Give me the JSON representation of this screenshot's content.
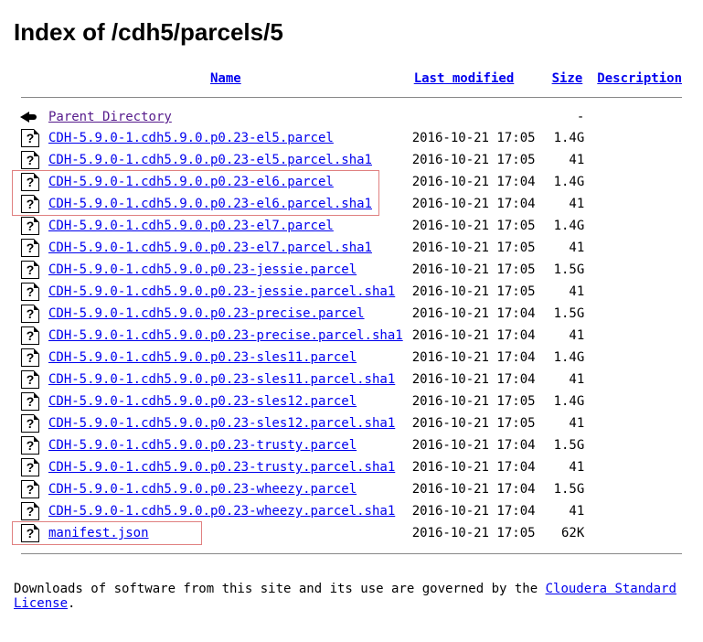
{
  "title": "Index of /cdh5/parcels/5",
  "headers": {
    "name": "Name",
    "last_modified": "Last modified",
    "size": "Size",
    "description": "Description"
  },
  "parent": {
    "label": "Parent Directory",
    "size": "-"
  },
  "files": [
    {
      "name": "CDH-5.9.0-1.cdh5.9.0.p0.23-el5.parcel",
      "date": "2016-10-21 17:05",
      "size": "1.4G"
    },
    {
      "name": "CDH-5.9.0-1.cdh5.9.0.p0.23-el5.parcel.sha1",
      "date": "2016-10-21 17:05",
      "size": "41"
    },
    {
      "name": "CDH-5.9.0-1.cdh5.9.0.p0.23-el6.parcel",
      "date": "2016-10-21 17:04",
      "size": "1.4G"
    },
    {
      "name": "CDH-5.9.0-1.cdh5.9.0.p0.23-el6.parcel.sha1",
      "date": "2016-10-21 17:04",
      "size": "41"
    },
    {
      "name": "CDH-5.9.0-1.cdh5.9.0.p0.23-el7.parcel",
      "date": "2016-10-21 17:05",
      "size": "1.4G"
    },
    {
      "name": "CDH-5.9.0-1.cdh5.9.0.p0.23-el7.parcel.sha1",
      "date": "2016-10-21 17:05",
      "size": "41"
    },
    {
      "name": "CDH-5.9.0-1.cdh5.9.0.p0.23-jessie.parcel",
      "date": "2016-10-21 17:05",
      "size": "1.5G"
    },
    {
      "name": "CDH-5.9.0-1.cdh5.9.0.p0.23-jessie.parcel.sha1",
      "date": "2016-10-21 17:05",
      "size": "41"
    },
    {
      "name": "CDH-5.9.0-1.cdh5.9.0.p0.23-precise.parcel",
      "date": "2016-10-21 17:04",
      "size": "1.5G"
    },
    {
      "name": "CDH-5.9.0-1.cdh5.9.0.p0.23-precise.parcel.sha1",
      "date": "2016-10-21 17:04",
      "size": "41"
    },
    {
      "name": "CDH-5.9.0-1.cdh5.9.0.p0.23-sles11.parcel",
      "date": "2016-10-21 17:04",
      "size": "1.4G"
    },
    {
      "name": "CDH-5.9.0-1.cdh5.9.0.p0.23-sles11.parcel.sha1",
      "date": "2016-10-21 17:04",
      "size": "41"
    },
    {
      "name": "CDH-5.9.0-1.cdh5.9.0.p0.23-sles12.parcel",
      "date": "2016-10-21 17:05",
      "size": "1.4G"
    },
    {
      "name": "CDH-5.9.0-1.cdh5.9.0.p0.23-sles12.parcel.sha1",
      "date": "2016-10-21 17:05",
      "size": "41"
    },
    {
      "name": "CDH-5.9.0-1.cdh5.9.0.p0.23-trusty.parcel",
      "date": "2016-10-21 17:04",
      "size": "1.5G"
    },
    {
      "name": "CDH-5.9.0-1.cdh5.9.0.p0.23-trusty.parcel.sha1",
      "date": "2016-10-21 17:04",
      "size": "41"
    },
    {
      "name": "CDH-5.9.0-1.cdh5.9.0.p0.23-wheezy.parcel",
      "date": "2016-10-21 17:04",
      "size": "1.5G"
    },
    {
      "name": "CDH-5.9.0-1.cdh5.9.0.p0.23-wheezy.parcel.sha1",
      "date": "2016-10-21 17:04",
      "size": "41"
    },
    {
      "name": "manifest.json",
      "date": "2016-10-21 17:05",
      "size": "62K"
    }
  ],
  "highlights": {
    "box1_rows": [
      2,
      3
    ],
    "box2_rows": [
      18
    ]
  },
  "footer": {
    "text_prefix": "Downloads of software from this site and its use are governed by the ",
    "link_text": "Cloudera Standard License",
    "text_suffix": "."
  }
}
